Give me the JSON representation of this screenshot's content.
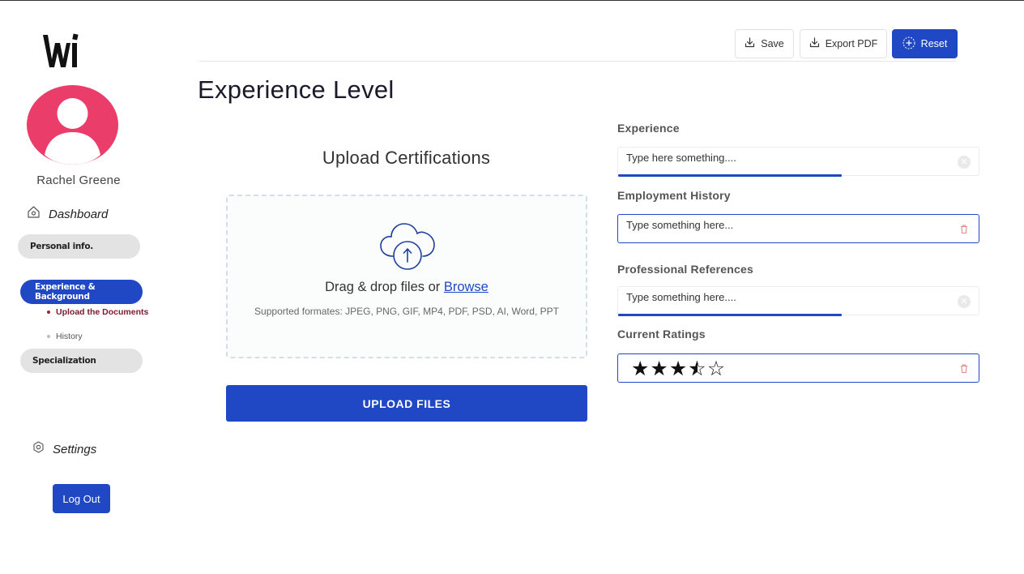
{
  "app": {
    "logo_text": "Wi"
  },
  "user": {
    "name": "Rachel Greene"
  },
  "sidebar": {
    "dashboard_label": "Dashboard",
    "items": [
      {
        "label": "Personal info."
      },
      {
        "label": "Experience & Background",
        "active": true
      },
      {
        "label": "Specialization"
      }
    ],
    "subitems": [
      {
        "label": "Upload the Documents",
        "active": true
      },
      {
        "label": "History"
      }
    ],
    "settings_label": "Settings",
    "logout_label": "Log Out"
  },
  "toolbar": {
    "save_label": "Save",
    "export_label": "Export PDF",
    "reset_label": "Reset"
  },
  "page": {
    "title": "Experience Level"
  },
  "upload": {
    "title": "Upload Certifications",
    "drag_text": "Drag & drop files or ",
    "browse_label": "Browse",
    "formats_text": "Supported formates: JPEG, PNG, GIF, MP4, PDF, PSD, AI, Word, PPT",
    "button_label": "UPLOAD FILES"
  },
  "form": {
    "experience": {
      "label": "Experience",
      "placeholder": "Type here something...."
    },
    "employment": {
      "label": "Employment History",
      "placeholder": "Type something here..."
    },
    "references": {
      "label": "Professional References",
      "placeholder": "Type something here...."
    },
    "ratings": {
      "label": "Current Ratings",
      "value": 3.5,
      "max": 5
    }
  },
  "colors": {
    "accent": "#2048c4",
    "avatar": "#ea3d6a",
    "active_subitem": "#7a1a2c",
    "pill_inactive": "#e3e3e3"
  }
}
